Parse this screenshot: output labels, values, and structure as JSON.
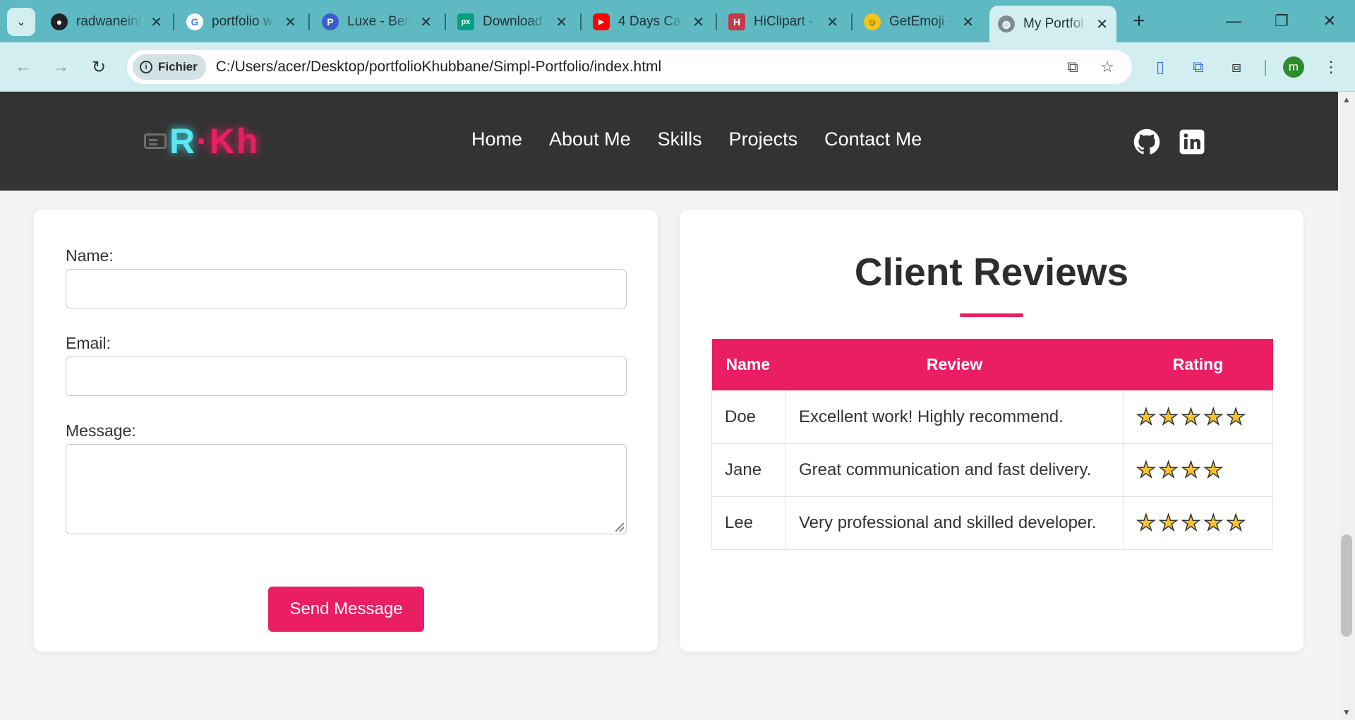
{
  "browser": {
    "tabs": [
      {
        "title": "radwaneinl",
        "icon": "github-icon"
      },
      {
        "title": "portfolio w",
        "icon": "google-icon"
      },
      {
        "title": "Luxe - Berr",
        "icon": "p-logo-icon"
      },
      {
        "title": "Download",
        "icon": "px-icon"
      },
      {
        "title": "4 Days Car",
        "icon": "youtube-icon"
      },
      {
        "title": "HiClipart -",
        "icon": "hiclipart-icon"
      },
      {
        "title": "GetEmoji -",
        "icon": "emoji-icon"
      },
      {
        "title": "My Portfol",
        "icon": "globe-icon",
        "active": true
      }
    ],
    "security_chip": "Fichier",
    "url": "C:/Users/acer/Desktop/portfolioKhubbane/Simpl-Portfolio/index.html",
    "profile_initial": "m",
    "colors": {
      "chrome": "#5fb9c2",
      "toolbar": "#d2eef1"
    }
  },
  "site": {
    "logo": {
      "r": "R",
      "dot": "·",
      "kh": "Kh"
    },
    "nav": [
      "Home",
      "About Me",
      "Skills",
      "Projects",
      "Contact Me"
    ],
    "social_icons": [
      "github-icon",
      "linkedin-icon"
    ],
    "colors": {
      "header": "#333333",
      "accent": "#e91e63",
      "logo_cyan": "#58e8f2"
    }
  },
  "contact_form": {
    "name_label": "Name:",
    "email_label": "Email:",
    "message_label": "Message:",
    "name_value": "",
    "email_value": "",
    "message_value": "",
    "submit_label": "Send Message"
  },
  "reviews": {
    "title": "Client Reviews",
    "headers": {
      "name": "Name",
      "review": "Review",
      "rating": "Rating"
    },
    "rows": [
      {
        "name": "Doe",
        "review": "Excellent work! Highly recommend.",
        "rating": 5
      },
      {
        "name": "Jane",
        "review": "Great communication and fast delivery.",
        "rating": 4
      },
      {
        "name": "Lee",
        "review": "Very professional and skilled developer.",
        "rating": 5
      }
    ],
    "star_glyph": "★"
  }
}
